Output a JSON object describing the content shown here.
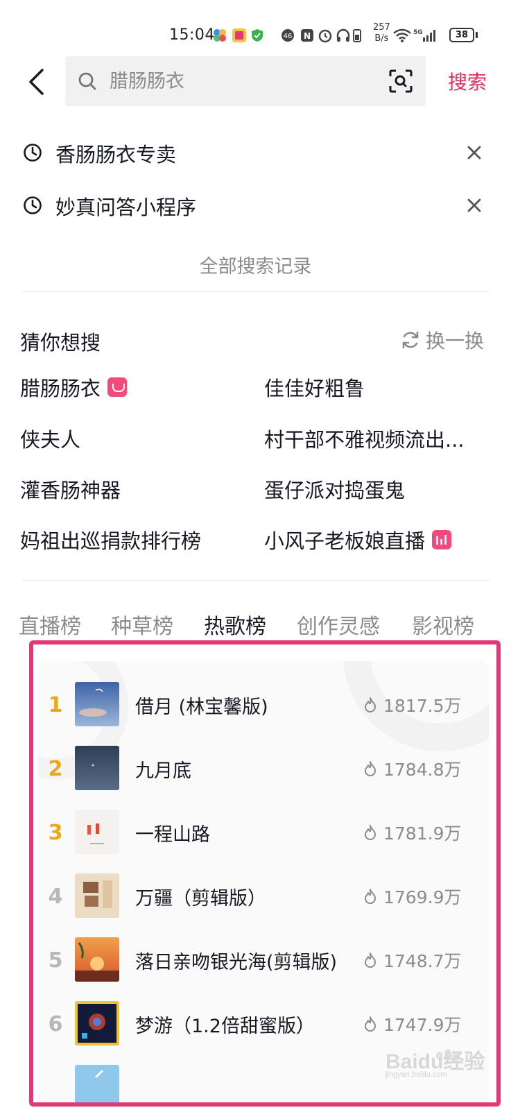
{
  "status_bar": {
    "time": "15:04",
    "net_speed_value": "257",
    "net_speed_unit": "B/s",
    "battery": "38",
    "icons": [
      "app-icon-1",
      "app-icon-2",
      "shield-icon",
      "nfc-icon",
      "alarm-icon",
      "headphones-icon",
      "wifi-icon",
      "signal-icon"
    ]
  },
  "search": {
    "placeholder": "腊肠肠衣",
    "submit_label": "搜索"
  },
  "history": {
    "items": [
      "香肠肠衣专卖",
      "妙真问答小程序"
    ],
    "all_label": "全部搜索记录"
  },
  "guess": {
    "title": "猜你想搜",
    "refresh_label": "换一换",
    "items": [
      {
        "text": "腊肠肠衣",
        "badge": "shop-icon"
      },
      {
        "text": "佳佳好粗鲁",
        "badge": ""
      },
      {
        "text": "侠夫人",
        "badge": ""
      },
      {
        "text": "村干部不雅视频流出...",
        "badge": ""
      },
      {
        "text": "灌香肠神器",
        "badge": ""
      },
      {
        "text": "蛋仔派对捣蛋鬼",
        "badge": ""
      },
      {
        "text": "妈祖出巡捐款排行榜",
        "badge": ""
      },
      {
        "text": "小风子老板娘直播",
        "badge": "live-icon"
      }
    ]
  },
  "tabs": [
    {
      "label": "直播榜",
      "active": false
    },
    {
      "label": "种草榜",
      "active": false
    },
    {
      "label": "热歌榜",
      "active": true
    },
    {
      "label": "创作灵感",
      "active": false
    },
    {
      "label": "影视榜",
      "active": false
    }
  ],
  "songs": [
    {
      "rank": "1",
      "title": "借月 (林宝馨版)",
      "heat": "1817.5万"
    },
    {
      "rank": "2",
      "title": "九月底",
      "heat": "1784.8万"
    },
    {
      "rank": "3",
      "title": "一程山路",
      "heat": "1781.9万"
    },
    {
      "rank": "4",
      "title": "万疆（剪辑版）",
      "heat": "1769.9万"
    },
    {
      "rank": "5",
      "title": "落日亲吻银光海(剪辑版)",
      "heat": "1748.7万"
    },
    {
      "rank": "6",
      "title": "梦游（1.2倍甜蜜版）",
      "heat": "1747.9万"
    }
  ],
  "watermark": {
    "brand": "Baidu经验",
    "url": "jingyan.baidu.com"
  },
  "colors": {
    "accent": "#e62e5c",
    "rank_top": "#e9a91a",
    "rank_other": "#b6b7bb",
    "highlight_frame": "#e2387a"
  }
}
